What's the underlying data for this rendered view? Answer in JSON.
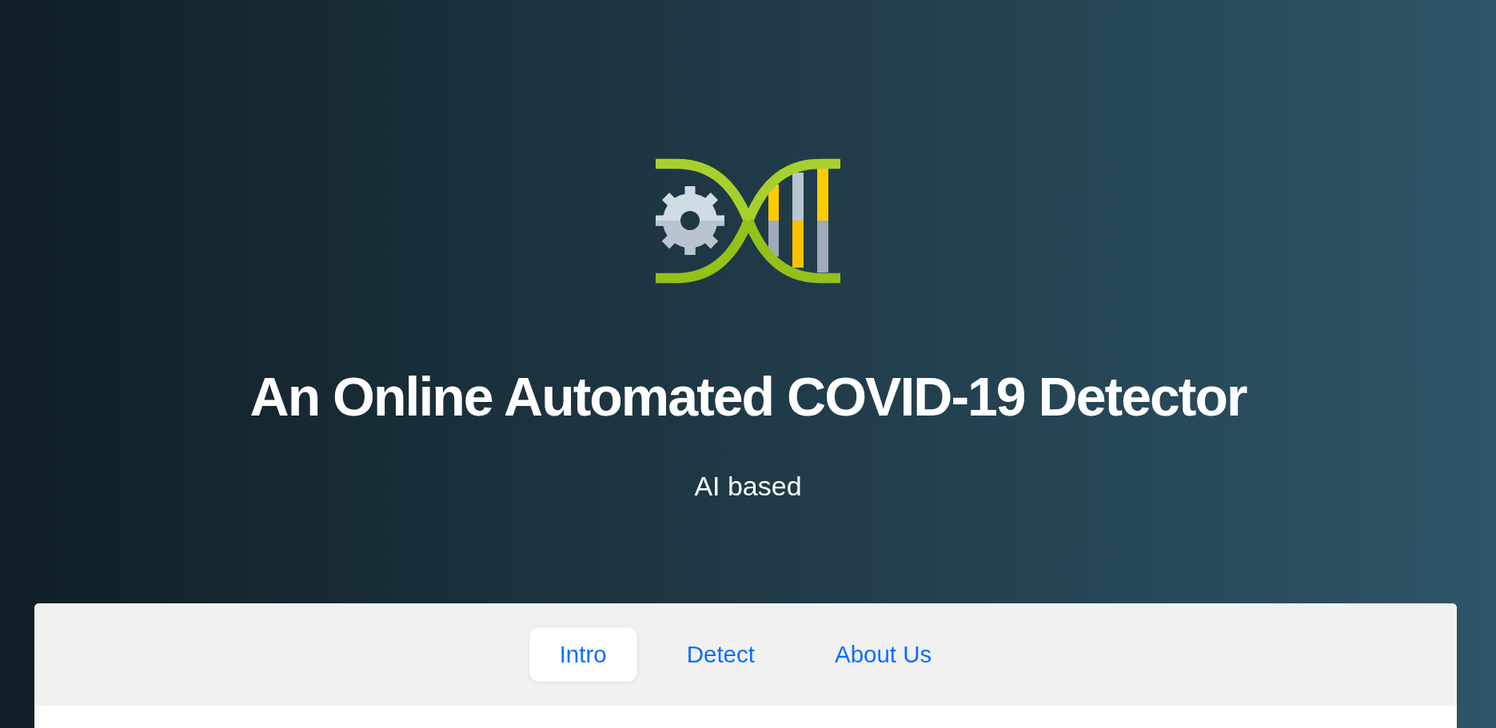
{
  "header": {
    "title": "An Online Automated COVID-19 Detector",
    "subtitle": "AI based"
  },
  "tabs": [
    {
      "label": "Intro",
      "selected": true
    },
    {
      "label": "Detect",
      "selected": false
    },
    {
      "label": "About Us",
      "selected": false
    }
  ]
}
